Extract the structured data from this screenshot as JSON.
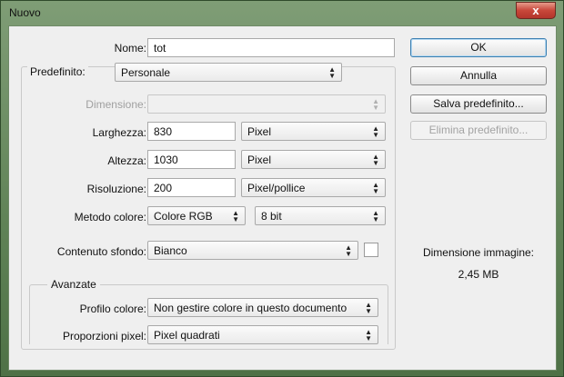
{
  "window": {
    "title": "Nuovo",
    "close_glyph": "x"
  },
  "form": {
    "nome": {
      "label": "Nome:",
      "value": "tot"
    },
    "predefinito": {
      "label": "Predefinito:",
      "value": "Personale"
    },
    "dimensione": {
      "label": "Dimensione:",
      "value": ""
    },
    "larghezza": {
      "label": "Larghezza:",
      "value": "830",
      "unit": "Pixel"
    },
    "altezza": {
      "label": "Altezza:",
      "value": "1030",
      "unit": "Pixel"
    },
    "risoluzione": {
      "label": "Risoluzione:",
      "value": "200",
      "unit": "Pixel/pollice"
    },
    "metodo_colore": {
      "label": "Metodo colore:",
      "mode": "Colore RGB",
      "depth": "8 bit"
    },
    "contenuto_sfondo": {
      "label": "Contenuto sfondo:",
      "value": "Bianco"
    }
  },
  "avanzate": {
    "legend": "Avanzate",
    "profilo_colore": {
      "label": "Profilo colore:",
      "value": "Non gestire colore in questo documento"
    },
    "proporzioni_pixel": {
      "label": "Proporzioni pixel:",
      "value": "Pixel quadrati"
    }
  },
  "buttons": {
    "ok": "OK",
    "annulla": "Annulla",
    "salva": "Salva predefinito...",
    "elimina": "Elimina predefinito..."
  },
  "info": {
    "label": "Dimensione immagine:",
    "value": "2,45 MB"
  },
  "icons": {
    "dropdown": "up-down-arrows-icon",
    "close": "close-icon"
  },
  "colors": {
    "default_button_border": "#3c7fb1",
    "window_frame": "#5f8256",
    "dialog_bg": "#efefef"
  }
}
